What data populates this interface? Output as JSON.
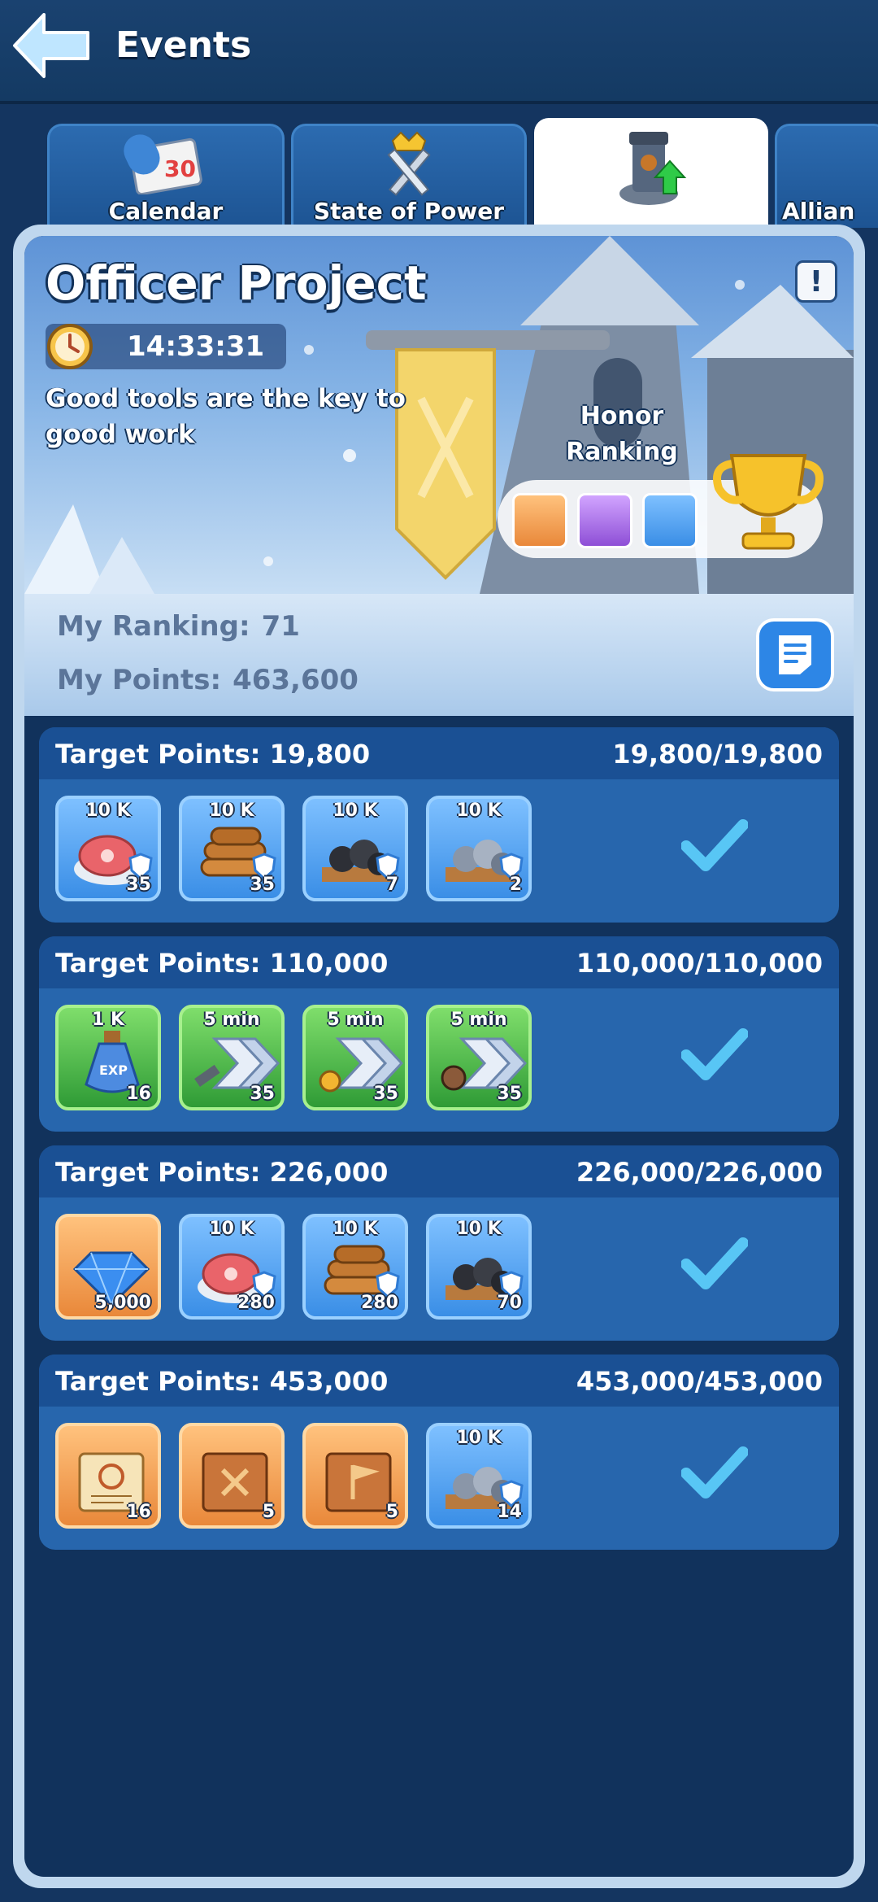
{
  "header": {
    "title": "Events"
  },
  "tabs": [
    {
      "label": "Calendar",
      "badge": "30"
    },
    {
      "label": "State of Power"
    },
    {
      "label": ""
    },
    {
      "label": "Allian"
    }
  ],
  "event": {
    "title": "Officer Project",
    "timer": "14:33:31",
    "description": "Good tools are the key to good work",
    "honor_label": "Honor Ranking",
    "info_symbol": "!"
  },
  "stats": {
    "ranking_label": "My Ranking:",
    "ranking_value": "71",
    "points_label": "My Points:",
    "points_value": "463,600"
  },
  "targets": [
    {
      "title": "Target Points: 19,800",
      "progress": "19,800/19,800",
      "rewards": [
        {
          "top": "10 K",
          "count": "35",
          "icon": "meat-icon"
        },
        {
          "top": "10 K",
          "count": "35",
          "icon": "wood-icon"
        },
        {
          "top": "10 K",
          "count": "7",
          "icon": "coal-icon"
        },
        {
          "top": "10 K",
          "count": "2",
          "icon": "iron-ore-icon"
        }
      ]
    },
    {
      "title": "Target Points: 110,000",
      "progress": "110,000/110,000",
      "rewards": [
        {
          "top": "1 K",
          "count": "16",
          "icon": "exp-potion-icon",
          "label": "EXP"
        },
        {
          "top": "5 min",
          "count": "35",
          "icon": "speedup-hammer-icon"
        },
        {
          "top": "5 min",
          "count": "35",
          "icon": "speedup-research-icon"
        },
        {
          "top": "5 min",
          "count": "35",
          "icon": "speedup-training-icon"
        }
      ]
    },
    {
      "title": "Target Points: 226,000",
      "progress": "226,000/226,000",
      "rewards": [
        {
          "top": "",
          "count": "5,000",
          "icon": "gem-icon"
        },
        {
          "top": "10 K",
          "count": "280",
          "icon": "meat-icon"
        },
        {
          "top": "10 K",
          "count": "280",
          "icon": "wood-icon"
        },
        {
          "top": "10 K",
          "count": "70",
          "icon": "coal-icon"
        }
      ]
    },
    {
      "title": "Target Points: 453,000",
      "progress": "453,000/453,000",
      "rewards": [
        {
          "top": "",
          "count": "16",
          "icon": "scroll-icon"
        },
        {
          "top": "",
          "count": "5",
          "icon": "tactics-book-icon"
        },
        {
          "top": "",
          "count": "5",
          "icon": "banner-book-icon"
        },
        {
          "top": "10 K",
          "count": "14",
          "icon": "iron-ore-icon"
        }
      ]
    }
  ],
  "colors": {
    "accent_blue": "#2766ad",
    "header_blue": "#1a5094",
    "check_color": "#58c6f5"
  }
}
